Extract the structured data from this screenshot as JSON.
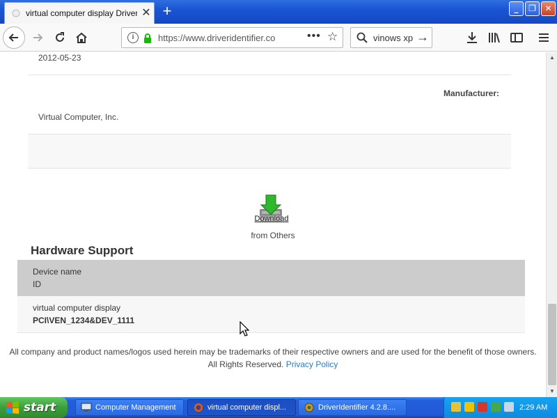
{
  "browser": {
    "tab_title": "virtual computer display Driver Do",
    "url": "https://www.driveridentifier.co",
    "search_text": "vinows xp"
  },
  "page": {
    "date": "2012-05-23",
    "manufacturer_label": "Manufacturer:",
    "manufacturer_value": "Virtual Computer, Inc.",
    "download_label": "Download",
    "download_from": "from Others",
    "hardware_title": "Hardware Support",
    "hardware_header": {
      "name": "Device name",
      "id": "ID"
    },
    "hardware_rows": [
      {
        "name": "virtual computer display",
        "id": "PCI\\VEN_1234&DEV_1111"
      }
    ],
    "footer_line1": "All company and product names/logos used herein may be trademarks of their respective owners and are used for the benefit of those owners.",
    "footer_line2": "All Rights Reserved.",
    "privacy_link": "Privacy Policy"
  },
  "taskbar": {
    "start_label": "start",
    "tasks": [
      {
        "label": "Computer Management",
        "active": false
      },
      {
        "label": "virtual computer displ...",
        "active": true
      },
      {
        "label": "DriverIdentifier 4.2.8....",
        "active": false
      }
    ],
    "clock": "2:29 AM"
  }
}
